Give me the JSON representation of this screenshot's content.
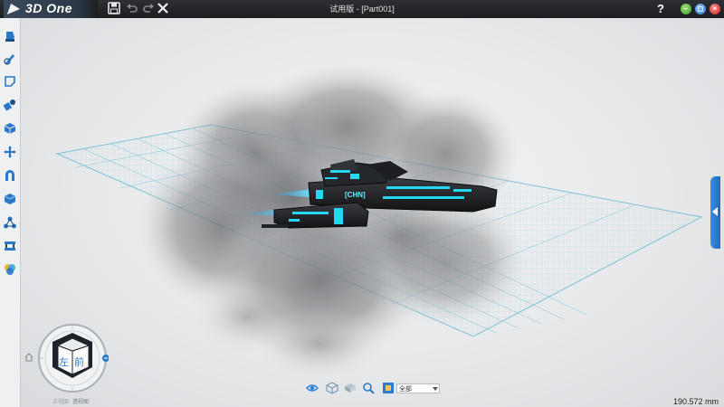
{
  "app": {
    "logo_text": "3D One",
    "window_title": "试用版 - [Part001]",
    "help_label": "?"
  },
  "quick_access": {
    "save": "save-icon",
    "undo": "undo-icon",
    "redo": "redo-icon",
    "close": "close-icon"
  },
  "window_controls": [
    "minimize",
    "restore",
    "close"
  ],
  "left_toolbar": {
    "tools": [
      {
        "icon": "basic-solid-icon"
      },
      {
        "icon": "sketch-icon"
      },
      {
        "icon": "sketch-edit-icon"
      },
      {
        "icon": "feature-icon"
      },
      {
        "icon": "special-function-icon"
      },
      {
        "icon": "basic-edit-icon"
      },
      {
        "icon": "combine-icon"
      },
      {
        "icon": "distance-measure-icon"
      },
      {
        "icon": "assembly-icon"
      },
      {
        "icon": "auto-snap-icon"
      },
      {
        "icon": "material-render-icon"
      }
    ]
  },
  "model": {
    "hull_label": "[CHN]",
    "accent_color": "#27d6f0",
    "body_color": "#1a1c1f"
  },
  "view_cube": {
    "left_face": "左",
    "front_face": "前",
    "label_1": "正视图",
    "label_2": "透视图"
  },
  "view_bar": {
    "icons": [
      "show-hide-icon",
      "render-mode-icon",
      "view-mode-icon",
      "view-zoom-icon",
      "filter-icon"
    ],
    "filter_value": "全部"
  },
  "status": {
    "distance": "190.572 mm"
  },
  "colors": {
    "title_bar": "#1c1e21",
    "grid": "#86c8dc",
    "panel_toggle": "#2a7bd3"
  }
}
